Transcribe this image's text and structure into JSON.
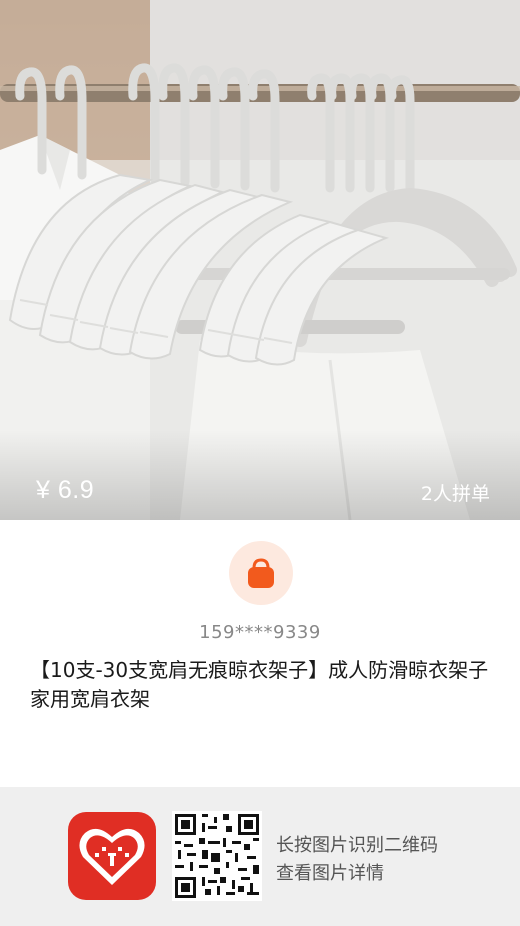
{
  "product": {
    "price": "¥ 6.9",
    "group_tag": "2人拼单",
    "title": "【10支-30支宽肩无痕晾衣架子】成人防滑晾衣架子家用宽肩衣架"
  },
  "seller": {
    "phone": "159****9339",
    "avatar_icon": "shopping-bag-icon"
  },
  "footer": {
    "app_logo_icon": "pinduoduo-logo-icon",
    "qr_icon": "qr-code-icon",
    "hint_line1": "长按图片识别二维码",
    "hint_line2": "查看图片详情"
  },
  "colors": {
    "brand_red": "#e02e24",
    "avatar_bg": "#fde9df",
    "bag_orange": "#f25a1d"
  }
}
